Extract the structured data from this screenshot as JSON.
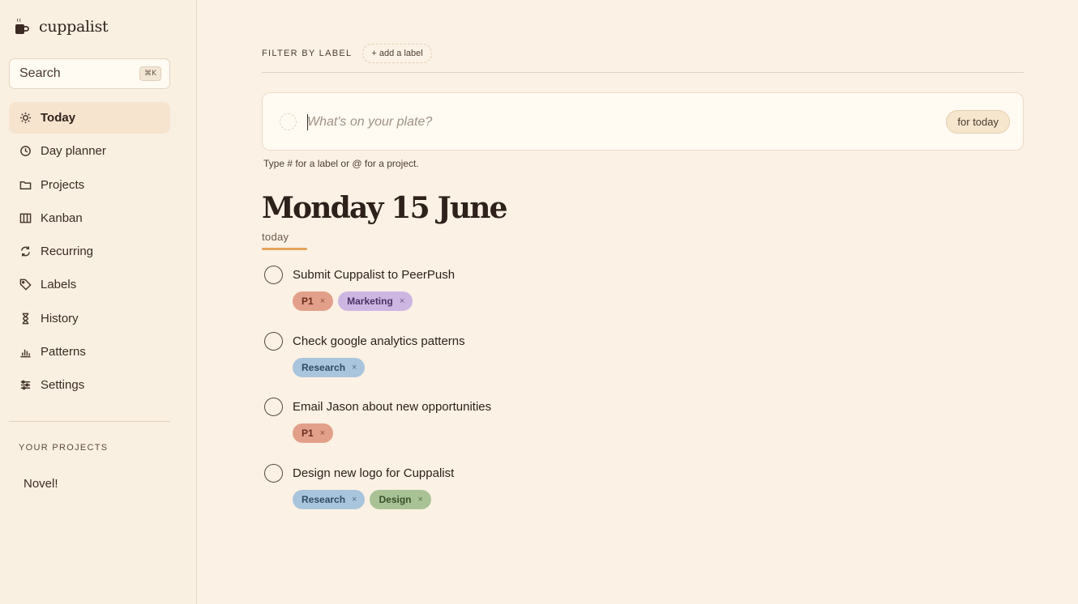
{
  "app": {
    "name": "cuppalist"
  },
  "search": {
    "label": "Search",
    "shortcut": "⌘K"
  },
  "nav": [
    {
      "label": "Today",
      "icon": "sun-icon",
      "active": true
    },
    {
      "label": "Day planner",
      "icon": "clock-icon"
    },
    {
      "label": "Projects",
      "icon": "folder-icon"
    },
    {
      "label": "Kanban",
      "icon": "columns-icon"
    },
    {
      "label": "Recurring",
      "icon": "repeat-icon"
    },
    {
      "label": "Labels",
      "icon": "tag-icon"
    },
    {
      "label": "History",
      "icon": "hourglass-icon"
    },
    {
      "label": "Patterns",
      "icon": "bar-chart-icon"
    },
    {
      "label": "Settings",
      "icon": "sliders-icon"
    }
  ],
  "projects_section": {
    "title": "YOUR PROJECTS",
    "items": [
      "Novel!"
    ]
  },
  "filter": {
    "label": "FILTER BY LABEL",
    "add_label": "+ add a label"
  },
  "composer": {
    "placeholder": "What's on your plate?",
    "button": "for today",
    "hint": "Type # for a label or @ for a project."
  },
  "day": {
    "title": "Monday 15 June",
    "subtitle": "today"
  },
  "tasks": [
    {
      "title": "Submit Cuppalist to PeerPush",
      "tags": [
        {
          "name": "P1",
          "kind": "p1"
        },
        {
          "name": "Marketing",
          "kind": "marketing"
        }
      ]
    },
    {
      "title": "Check google analytics patterns",
      "tags": [
        {
          "name": "Research",
          "kind": "research"
        }
      ]
    },
    {
      "title": "Email Jason about new opportunities",
      "tags": [
        {
          "name": "P1",
          "kind": "p1"
        }
      ]
    },
    {
      "title": "Design new logo for Cuppalist",
      "tags": [
        {
          "name": "Research",
          "kind": "research"
        },
        {
          "name": "Design",
          "kind": "design"
        }
      ]
    }
  ],
  "tag_remove_glyph": "×",
  "colors": {
    "background": "#fbf1e4",
    "accent": "#e6a35c",
    "p1": "#e2a08a",
    "marketing": "#cdb6e2",
    "research": "#a9c5dd",
    "design": "#a9c295"
  }
}
